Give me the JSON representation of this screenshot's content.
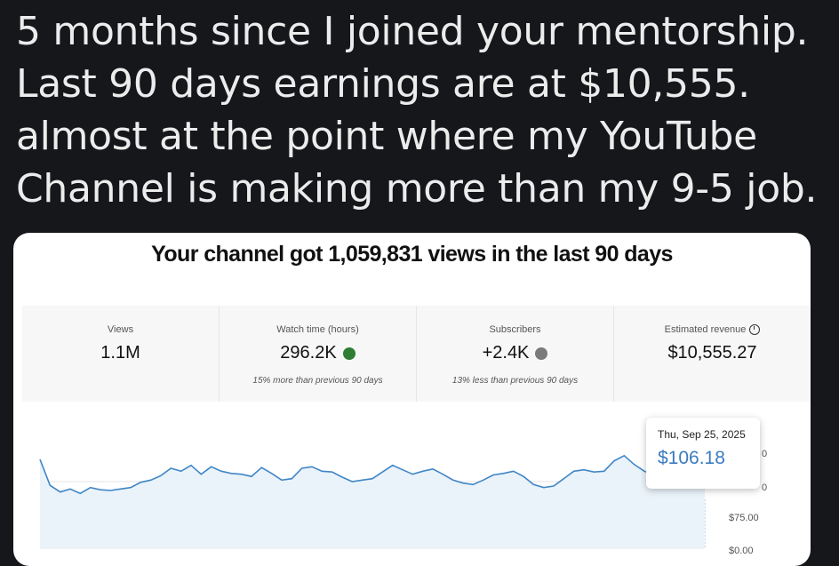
{
  "post": {
    "lines": [
      "5 months since I joined your mentorship.",
      "Last 90 days earnings are at $10,555.",
      "almost at the point where my YouTube",
      "Channel is making more than my 9-5 job."
    ]
  },
  "card": {
    "headline": "Your channel got 1,059,831 views in the last 90 days",
    "metrics": [
      {
        "label": "Views",
        "value": "1.1M",
        "sub": ""
      },
      {
        "label": "Watch time (hours)",
        "value": "296.2K",
        "sub": "15% more than previous 90 days",
        "trend": "up"
      },
      {
        "label": "Subscribers",
        "value": "+2.4K",
        "sub": "13% less than previous 90 days",
        "trend": "down"
      },
      {
        "label": "Estimated revenue",
        "value": "$10,555.27",
        "sub": ""
      }
    ],
    "tooltip": {
      "date": "Thu, Sep 25, 2025",
      "value": "$106.18"
    },
    "axis": {
      "labels": [
        "0",
        "0",
        "$75.00",
        "$0.00"
      ]
    }
  },
  "colors": {
    "line": "#3f86c6",
    "up": "#2e7d32",
    "down": "#7a7a7a"
  },
  "chart_data": {
    "type": "line",
    "ylabel": "",
    "ylim": [
      0,
      150
    ],
    "values": [
      120,
      85,
      76,
      80,
      74,
      82,
      79,
      78,
      80,
      82,
      89,
      92,
      98,
      108,
      104,
      112,
      100,
      110,
      104,
      101,
      100,
      97,
      109,
      101,
      92,
      94,
      108,
      110,
      104,
      103,
      96,
      90,
      92,
      94,
      103,
      112,
      106,
      100,
      104,
      107,
      100,
      92,
      88,
      86,
      92,
      99,
      101,
      104,
      97,
      86,
      82,
      84,
      94,
      104,
      106,
      103,
      104,
      118,
      125,
      113,
      104,
      98,
      90,
      86,
      89,
      92,
      106
    ]
  }
}
